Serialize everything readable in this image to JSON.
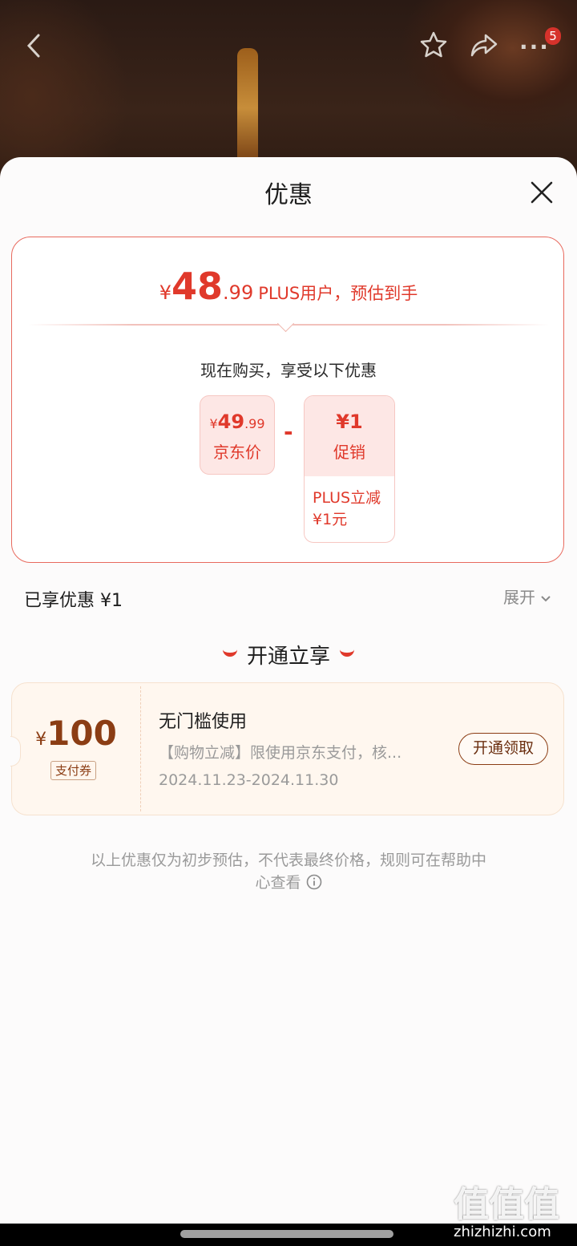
{
  "header": {
    "notification_count": "5"
  },
  "sheet": {
    "title": "优惠"
  },
  "price_card": {
    "yen": "¥",
    "estimate_int": "48",
    "estimate_dec": ".99",
    "estimate_label": "PLUS用户，预估到手",
    "buy_now_text": "现在购买，享受以下优惠",
    "jd_price": {
      "yen": "¥",
      "int": "49",
      "dec": ".99",
      "label": "京东价"
    },
    "operator": "-",
    "promo": {
      "amount": "¥1",
      "label": "促销",
      "detail_line1": "PLUS立减",
      "detail_line2": "¥1元"
    }
  },
  "summary": {
    "enjoyed": "已享优惠 ¥1",
    "expand": "展开"
  },
  "open_section": {
    "title": "开通立享"
  },
  "coupon": {
    "yen": "¥",
    "amount": "100",
    "type": "支付券",
    "title": "无门槛使用",
    "description": "【购物立减】限使用京东支付，核...",
    "date_range": "2024.11.23-2024.11.30",
    "button": "开通领取"
  },
  "disclaimer": {
    "line1": "以上优惠仅为初步预估，不代表最终价格，规则可在帮助中",
    "line2": "心查看"
  },
  "watermark": {
    "main": "值值值",
    "sub": "zhizhizhi.com"
  },
  "colors": {
    "accent": "#e0392b",
    "coupon_brown": "#8b3d14"
  }
}
